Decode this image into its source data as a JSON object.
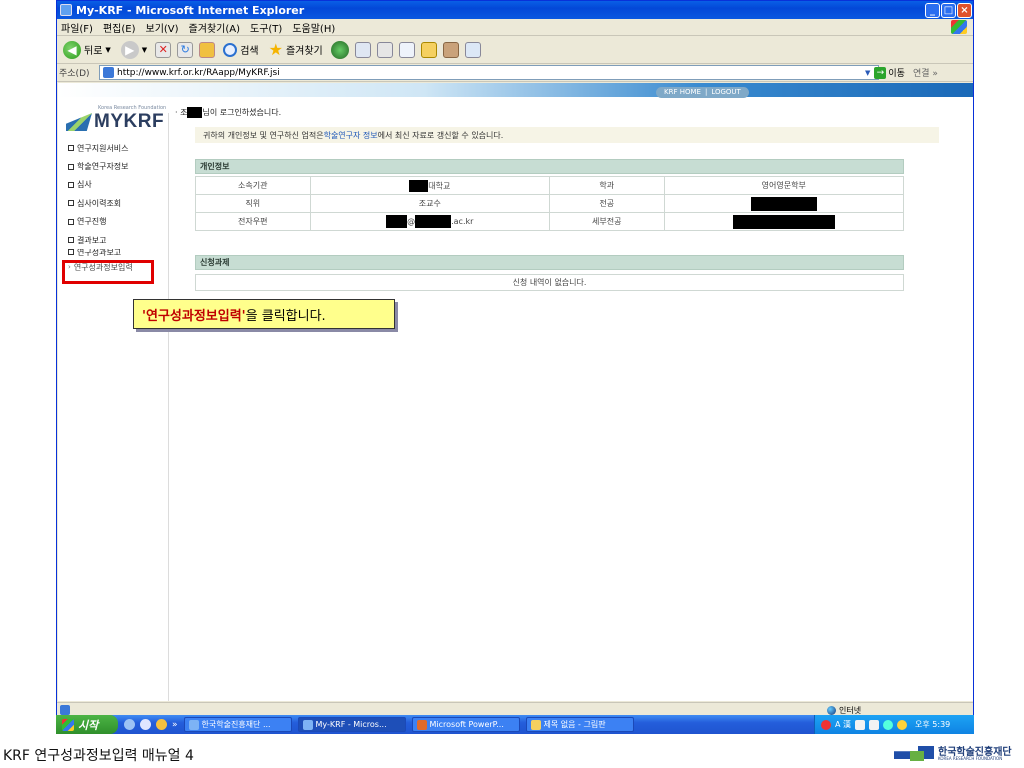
{
  "window": {
    "title": "My-KRF - Microsoft Internet Explorer",
    "minimize": "_",
    "maximize": "□",
    "close": "×"
  },
  "menu": [
    "파일(F)",
    "편집(E)",
    "보기(V)",
    "즐겨찾기(A)",
    "도구(T)",
    "도움말(H)"
  ],
  "toolbar": {
    "back_label": "뒤로",
    "search_label": "검색",
    "favorites_label": "즐겨찾기"
  },
  "address": {
    "label": "주소(D)",
    "url": "http://www.krf.or.kr/RAapp/MyKRF.jsi",
    "go_label": "이동",
    "links_label": "연결 »"
  },
  "page": {
    "top_links": [
      "KRF HOME",
      "|",
      "LOGOUT"
    ],
    "logo": {
      "subtitle": "Korea Research Foundation",
      "text": "MYKRF"
    },
    "welcome": {
      "name_prefix": "· 조",
      "suffix": "님이 로그인하셨습니다."
    },
    "notice": {
      "before": "귀하의 개인정보 및 연구하신 업적은 ",
      "link": "학술연구자 정보",
      "after": "에서 최신 자료로 갱신할 수 있습니다."
    },
    "sidebar": {
      "items": [
        {
          "label": "연구지원서비스"
        },
        {
          "label": "학술연구자정보"
        },
        {
          "label": "심사"
        },
        {
          "label": "심사이력조회"
        },
        {
          "label": "연구진행"
        },
        {
          "label": "결과보고"
        },
        {
          "label": "연구성과보고"
        }
      ],
      "sub_item": "연구성과정보입력"
    },
    "personal_info": {
      "title": "개인정보",
      "rows": [
        {
          "label1": "소속기관",
          "value1": "대학교",
          "label2": "학과",
          "value2": "영어영문학부"
        },
        {
          "label1": "직위",
          "value1": "조교수",
          "label2": "전공",
          "value2": ""
        },
        {
          "label1": "전자우편",
          "value1": ".ac.kr",
          "label2": "세부전공",
          "value2": ""
        }
      ]
    },
    "applications": {
      "title": "신청과제",
      "empty_message": "신청 내역이 없습니다."
    }
  },
  "callout": {
    "highlight": "'연구성과정보입력'",
    "rest": " 을 클릭합니다."
  },
  "statusbar": {
    "zone": "인터넷"
  },
  "taskbar": {
    "start_label": "시작",
    "tasks": [
      "한국학술진흥재단 ...",
      "My-KRF - Micros...",
      "Microsoft PowerP...",
      "제목 없음 - 그림판"
    ],
    "clock": "오후 5:39",
    "ime": "A 漢"
  },
  "footer": {
    "title": "KRF 연구성과정보입력 매뉴얼 4",
    "org_ko": "한국학술진흥재단",
    "org_en": "KOREA RESEARCH FOUNDATION"
  },
  "colors": {
    "highlight_border": "#e00000",
    "callout_bg": "#ffff8c",
    "section_header": "#c7ddd3",
    "titlebar": "#0348d8"
  }
}
